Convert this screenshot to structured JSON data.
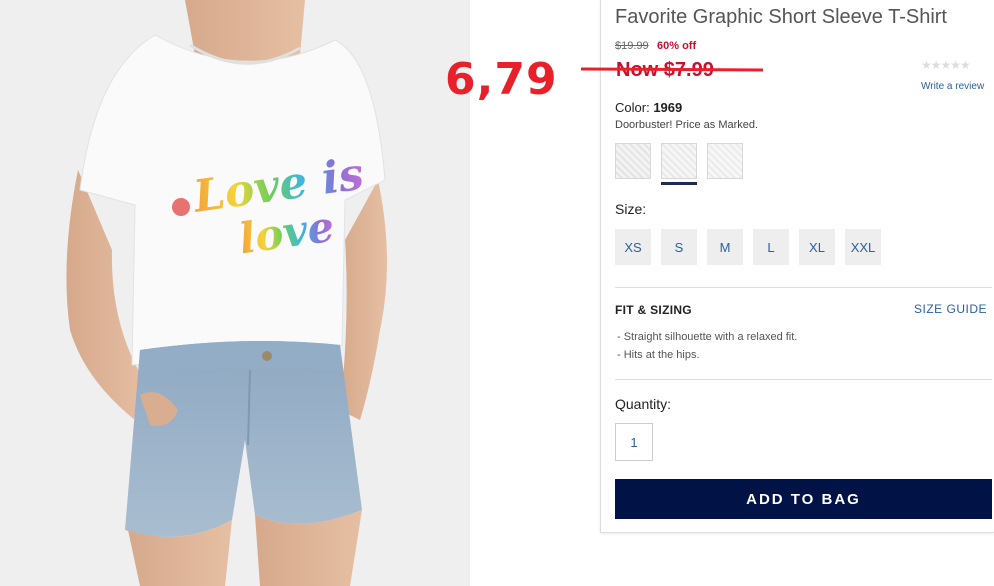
{
  "annotation": {
    "text": "6,79",
    "color": "#e8202a"
  },
  "product": {
    "title": "Favorite Graphic Short Sleeve T-Shirt",
    "image_alt": "Woman wearing white tee with rainbow Love is love graphic and denim shorts",
    "graphic_text_line1": "Love is",
    "graphic_text_line2": "love"
  },
  "price": {
    "original": "$19.99",
    "discount": "60% off",
    "now": "Now $7.99",
    "sale_color": "#c8102e"
  },
  "reviews": {
    "stars": "★★★★★",
    "write_label": "Write a review"
  },
  "color": {
    "label": "Color:",
    "value": "1969",
    "note": "Doorbuster! Price as Marked.",
    "selected_index": 1,
    "swatches": [
      "swatch-1",
      "swatch-2",
      "swatch-3"
    ]
  },
  "size": {
    "label": "Size:",
    "options": [
      "XS",
      "S",
      "M",
      "L",
      "XL",
      "XXL"
    ]
  },
  "fit": {
    "title": "FIT & SIZING",
    "guide_label": "SIZE GUIDE",
    "items": [
      "- Straight silhouette with a relaxed fit.",
      "- Hits at the hips."
    ]
  },
  "quantity": {
    "label": "Quantity:",
    "value": "1"
  },
  "cart": {
    "add_label": "ADD TO BAG",
    "button_color": "#001246"
  },
  "accent_color": "#2b5f9e"
}
